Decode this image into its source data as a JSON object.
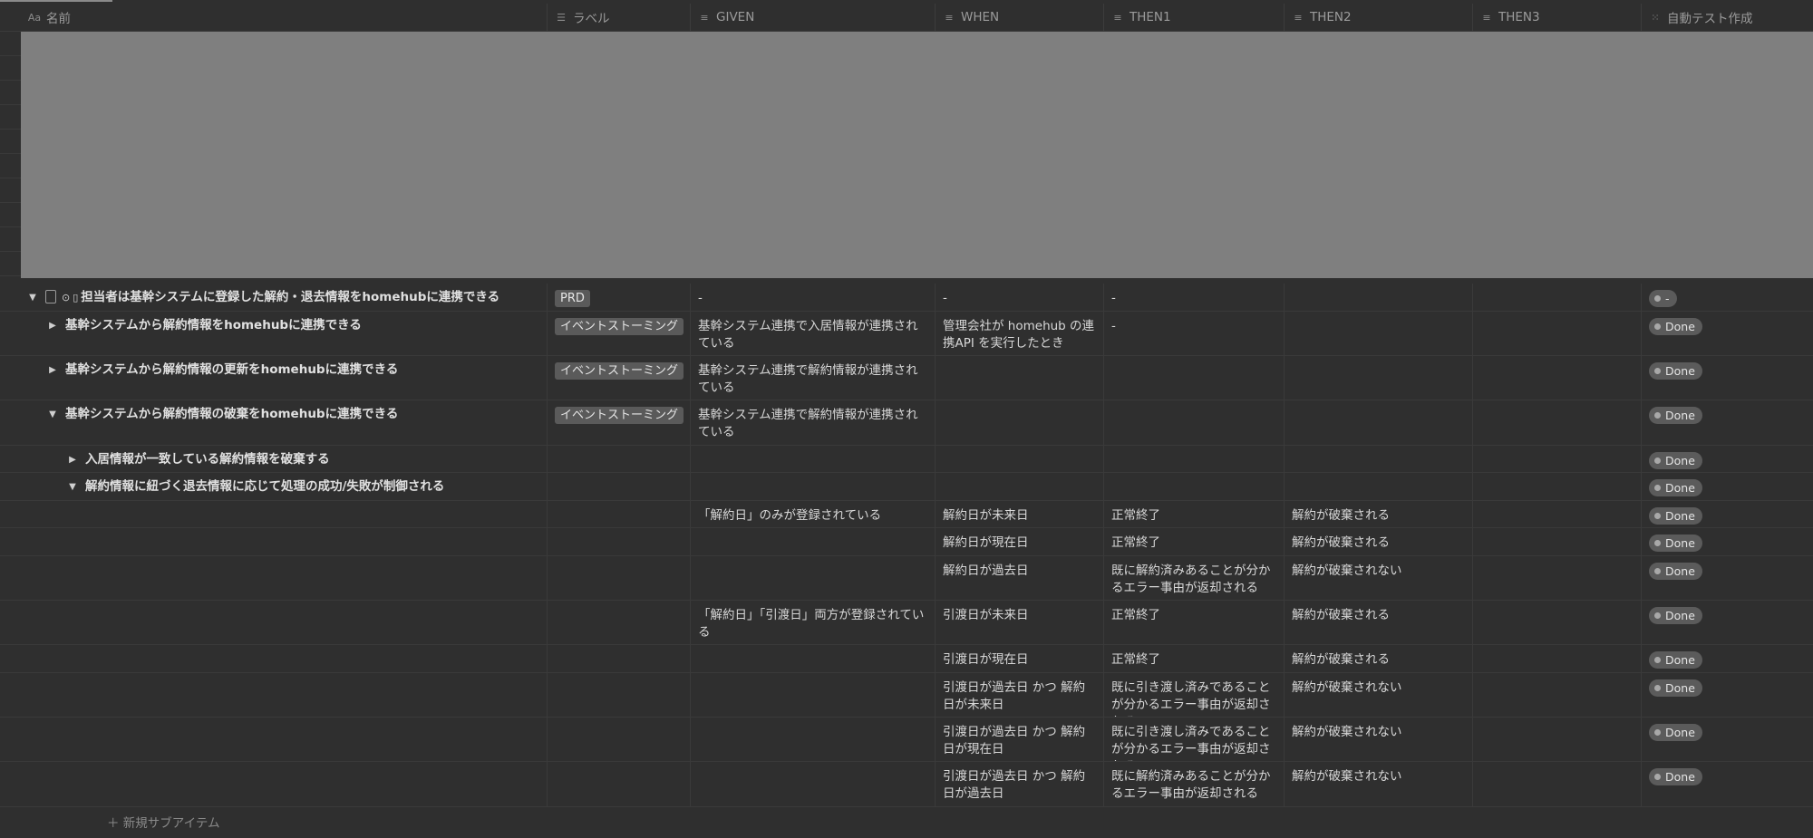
{
  "header": {
    "name": "名前",
    "label": "ラベル",
    "given": "GIVEN",
    "when": "WHEN",
    "then1": "THEN1",
    "then2": "THEN2",
    "then3": "THEN3",
    "autotest": "自動テスト作成"
  },
  "icons": {
    "name": "Aa",
    "list": "☰",
    "text": "≡",
    "status": "⁙"
  },
  "rows": [
    {
      "name": "担当者は基幹システムに登録した解約・退去情報をhomehubに連携できる",
      "label": "PRD",
      "given": "-",
      "when": "-",
      "then1": "-",
      "then2": "",
      "then3": "",
      "status": "-"
    },
    {
      "name": "基幹システムから解約情報をhomehubに連携できる",
      "label": "イベントストーミング",
      "given": "基幹システム連携で入居情報が連携されている",
      "when": "管理会社が homehub の連携API を実行したとき",
      "then1": "-",
      "then2": "",
      "then3": "",
      "status": "Done"
    },
    {
      "name": "基幹システムから解約情報の更新をhomehubに連携できる",
      "label": "イベントストーミング",
      "given": "基幹システム連携で解約情報が連携されている",
      "when": "",
      "then1": "",
      "then2": "",
      "then3": "",
      "status": "Done"
    },
    {
      "name": "基幹システムから解約情報の破棄をhomehubに連携できる",
      "label": "イベントストーミング",
      "given": "基幹システム連携で解約情報が連携されている",
      "when": "",
      "then1": "",
      "then2": "",
      "then3": "",
      "status": "Done"
    },
    {
      "name": "入居情報が一致している解約情報を破棄する",
      "label": "",
      "given": "",
      "when": "",
      "then1": "",
      "then2": "",
      "then3": "",
      "status": "Done"
    },
    {
      "name": "解約情報に紐づく退去情報に応じて処理の成功/失敗が制御される",
      "label": "",
      "given": "",
      "when": "",
      "then1": "",
      "then2": "",
      "then3": "",
      "status": "Done"
    },
    {
      "name": "",
      "label": "",
      "given": "「解約日」のみが登録されている",
      "when": "解約日が未来日",
      "then1": "正常終了",
      "then2": "解約が破棄される",
      "then3": "",
      "status": "Done"
    },
    {
      "name": "",
      "label": "",
      "given": "",
      "when": "解約日が現在日",
      "then1": "正常終了",
      "then2": "解約が破棄される",
      "then3": "",
      "status": "Done"
    },
    {
      "name": "",
      "label": "",
      "given": "",
      "when": "解約日が過去日",
      "then1": "既に解約済みあることが分かるエラー事由が返却される",
      "then2": "解約が破棄されない",
      "then3": "",
      "status": "Done"
    },
    {
      "name": "",
      "label": "",
      "given": "「解約日」「引渡日」両方が登録されている",
      "when": "引渡日が未来日",
      "then1": "正常終了",
      "then2": "解約が破棄される",
      "then3": "",
      "status": "Done"
    },
    {
      "name": "",
      "label": "",
      "given": "",
      "when": "引渡日が現在日",
      "then1": "正常終了",
      "then2": "解約が破棄される",
      "then3": "",
      "status": "Done"
    },
    {
      "name": "",
      "label": "",
      "given": "",
      "when": "引渡日が過去日 かつ 解約日が未来日",
      "then1": "既に引き渡し済みであることが分かるエラー事由が返却される",
      "then2": "解約が破棄されない",
      "then3": "",
      "status": "Done"
    },
    {
      "name": "",
      "label": "",
      "given": "",
      "when": "引渡日が過去日 かつ 解約日が現在日",
      "then1": "既に引き渡し済みであることが分かるエラー事由が返却される",
      "then2": "解約が破棄されない",
      "then3": "",
      "status": "Done"
    },
    {
      "name": "",
      "label": "",
      "given": "",
      "when": "引渡日が過去日 かつ 解約日が過去日",
      "then1": "既に解約済みあることが分かるエラー事由が返却される",
      "then2": "解約が破棄されない",
      "then3": "",
      "status": "Done"
    }
  ],
  "footer": {
    "new_subitem": "新規サブアイテム"
  }
}
